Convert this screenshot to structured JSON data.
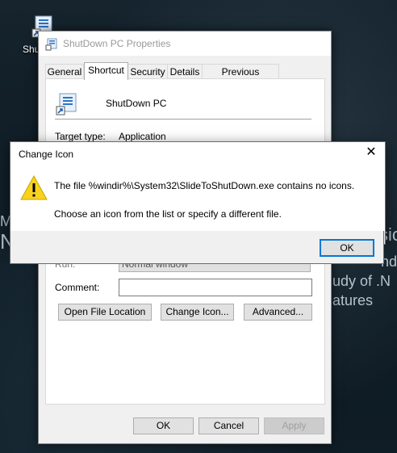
{
  "desktop": {
    "icon_label": "Shu",
    "background_fragments": [
      "M",
      "N",
      "sic",
      "nd",
      "udy of .N",
      "atures"
    ]
  },
  "properties": {
    "title": "ShutDown PC Properties",
    "tabs": [
      {
        "label": "General"
      },
      {
        "label": "Shortcut",
        "active": true
      },
      {
        "label": "Security"
      },
      {
        "label": "Details"
      },
      {
        "label": "Previous Versions"
      }
    ],
    "app_name": "ShutDown PC",
    "target_type_label": "Target type:",
    "target_type_value": "Application",
    "run_label": "Run:",
    "run_value": "Normal window",
    "comment_label": "Comment:",
    "comment_value": "",
    "buttons": {
      "open_file_location": "Open File Location",
      "change_icon": "Change Icon...",
      "advanced": "Advanced..."
    },
    "footer": {
      "ok": "OK",
      "cancel": "Cancel",
      "apply": "Apply"
    }
  },
  "change_icon_dialog": {
    "title": "Change Icon",
    "close_glyph": "✕",
    "message_line1": "The file %windir%\\System32\\SlideToShutDown.exe contains no icons.",
    "message_line2": "Choose an icon from the list or specify a different file.",
    "ok": "OK"
  },
  "colors": {
    "accent": "#0078d7",
    "warning": "#f7d21e"
  }
}
